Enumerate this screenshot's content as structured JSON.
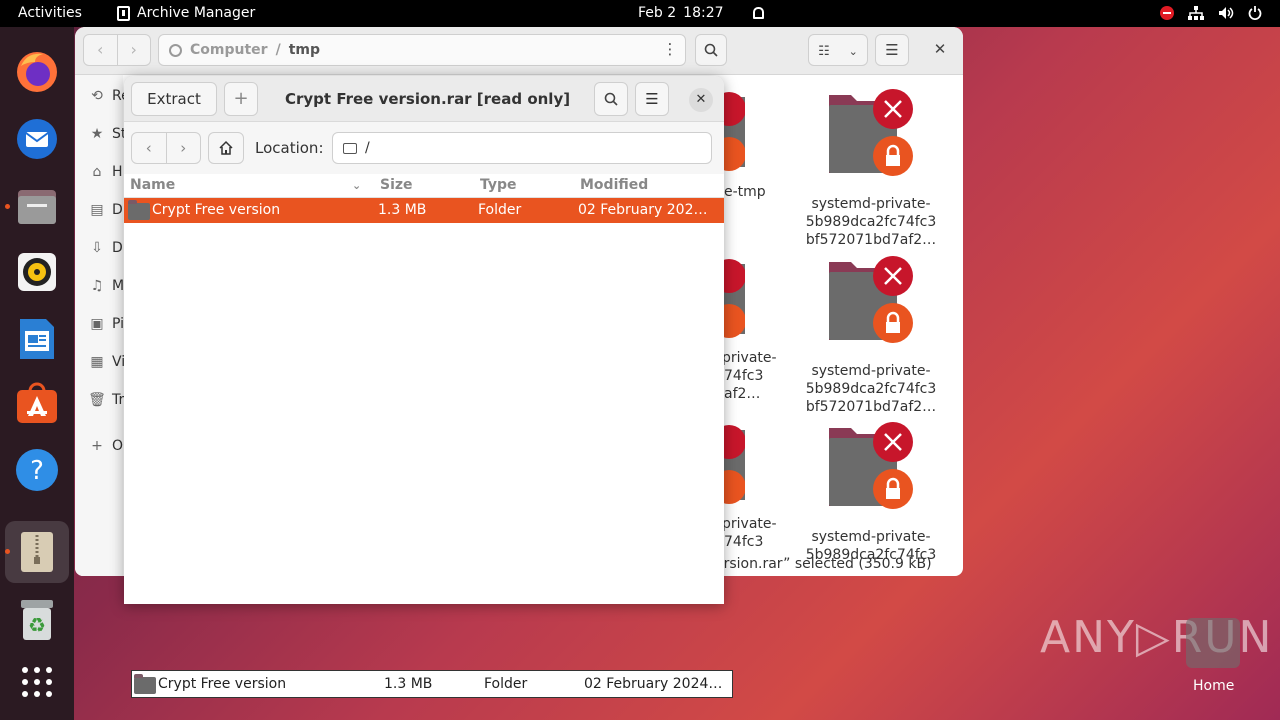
{
  "topbar": {
    "activities": "Activities",
    "app_name": "Archive Manager",
    "date": "Feb 2",
    "time": "18:27"
  },
  "dock": {
    "items": [
      "firefox-icon",
      "thunderbird-icon",
      "files-icon",
      "rhythmbox-icon",
      "writer-icon",
      "app-center-icon",
      "help-icon",
      "archive-manager-icon",
      "trash-icon",
      "show-apps-icon"
    ]
  },
  "files": {
    "path_root": "Computer",
    "path_sep": "/",
    "path_current": "tmp",
    "sidebar_labels": [
      "Re",
      "St",
      "H",
      "D",
      "D",
      "M",
      "Pi",
      "Vi",
      "Tr",
      "O"
    ],
    "grid_captions": [
      [
        "systemd-private-",
        "5b989dca2fc74fc3",
        "bf572071bd7af2…"
      ],
      [
        "systemd-private-",
        "5b989dca2fc74fc3",
        "bf572071bd7af2…"
      ],
      [
        "systemd-private-",
        "5b989dca2fc74fc3"
      ]
    ],
    "partial_captions": [
      "e-tmp",
      "private-",
      "74fc3",
      "af2…",
      "private-",
      "74fc3"
    ],
    "status": "ersion.rar” selected  (350.9 kB)"
  },
  "archive": {
    "extract_label": "Extract",
    "add_label": "+",
    "title": "Crypt Free version.rar [read only]",
    "location_label": "Location:",
    "location_value": "/",
    "columns": {
      "name": "Name",
      "size": "Size",
      "type": "Type",
      "modified": "Modified"
    },
    "rows": [
      {
        "name": "Crypt Free version",
        "size": "1.3 MB",
        "type": "Folder",
        "modified": "02 February 202…"
      }
    ]
  },
  "drag": {
    "name": "Crypt Free version",
    "size": "1.3 MB",
    "type": "Folder",
    "modified": "02 February 2024…"
  },
  "desktop": {
    "watermark": "ANY▷RUN",
    "home_label": "Home"
  },
  "colors": {
    "accent": "#e95420",
    "topbar": "#000000",
    "lock_red": "#c7162b"
  }
}
